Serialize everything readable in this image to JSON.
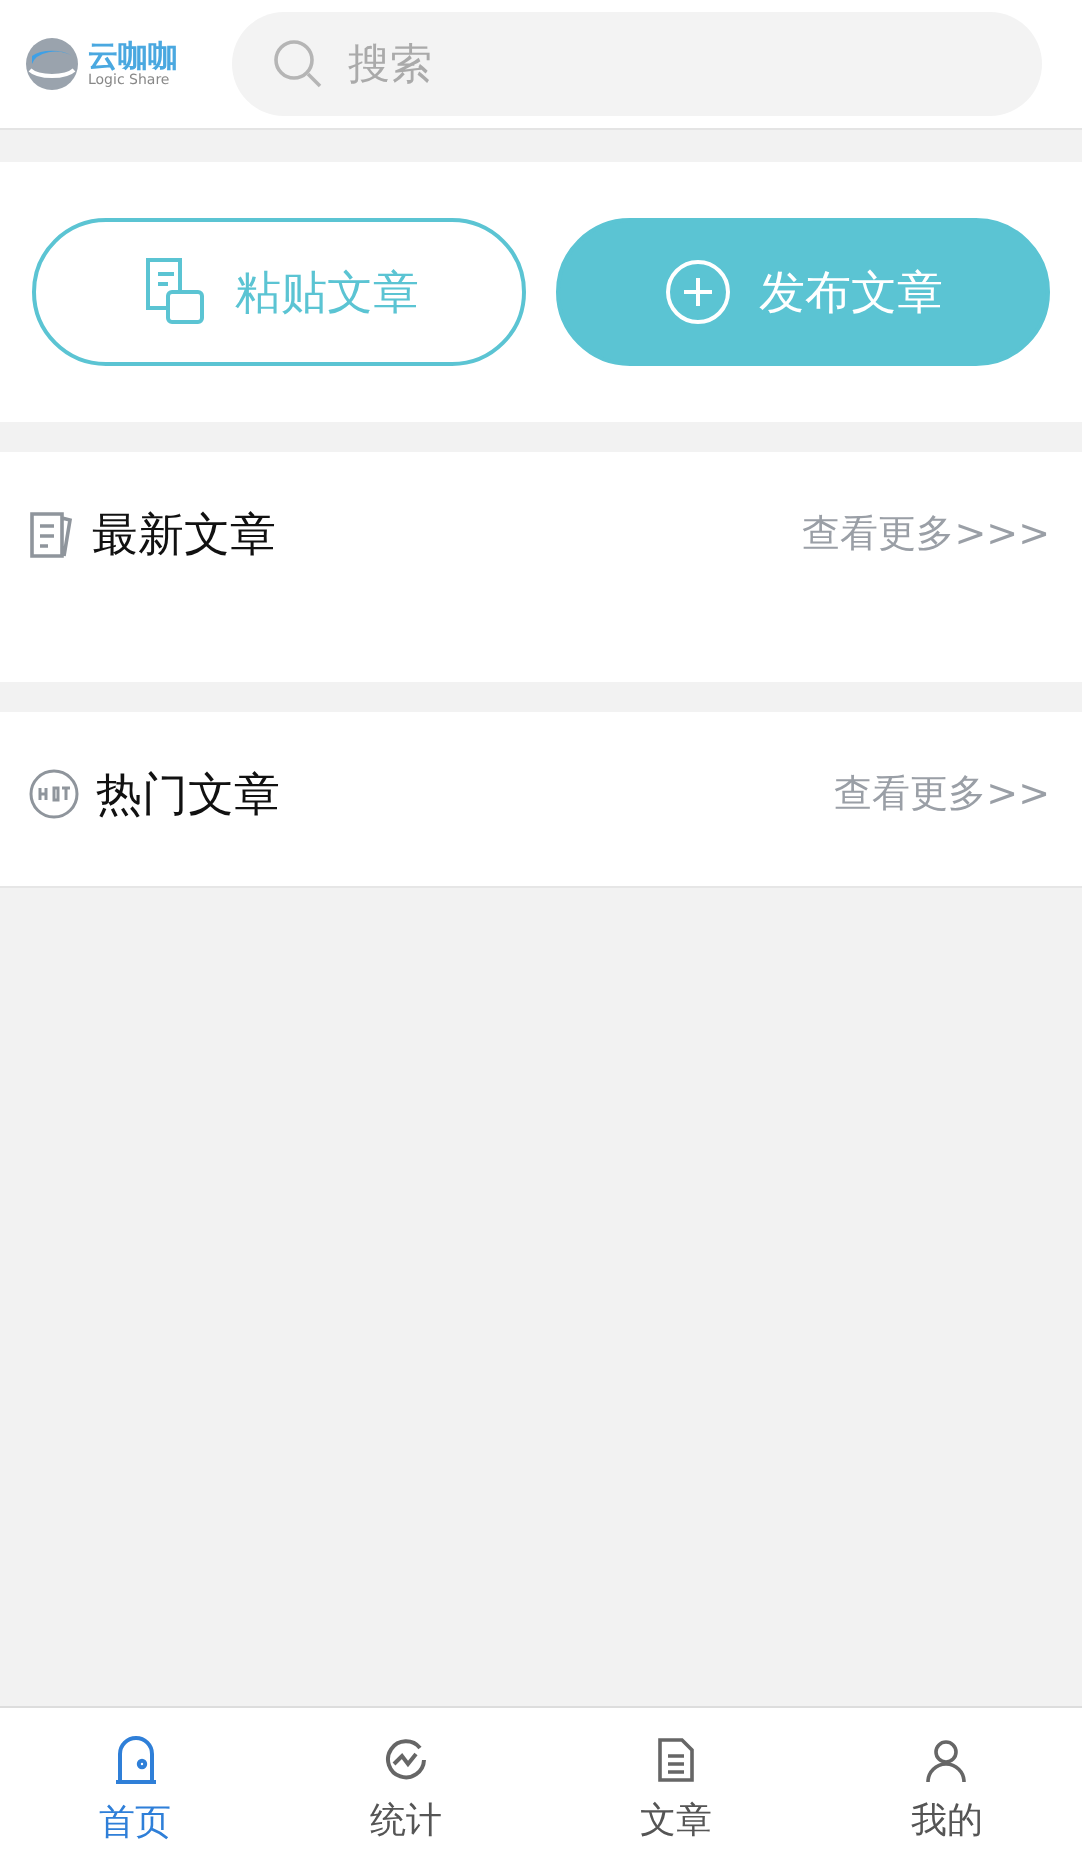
{
  "header": {
    "logo": {
      "name": "云咖咖",
      "tagline": "Logic Share"
    },
    "search": {
      "placeholder": "搜索"
    }
  },
  "actions": [
    {
      "kind": "outline",
      "label": "粘贴文章"
    },
    {
      "kind": "filled",
      "label": "发布文章"
    }
  ],
  "sections": [
    {
      "kind": "latest",
      "title": "最新文章",
      "more": "查看更多>>>"
    },
    {
      "kind": "hot",
      "title": "热门文章",
      "more": "查看更多>>"
    }
  ],
  "tab_bar": [
    {
      "kind": "home",
      "label": "首页",
      "selected": true
    },
    {
      "kind": "stats",
      "label": "统计",
      "selected": false
    },
    {
      "kind": "article",
      "label": "文章",
      "selected": false
    },
    {
      "kind": "me",
      "label": "我的",
      "selected": false
    }
  ]
}
